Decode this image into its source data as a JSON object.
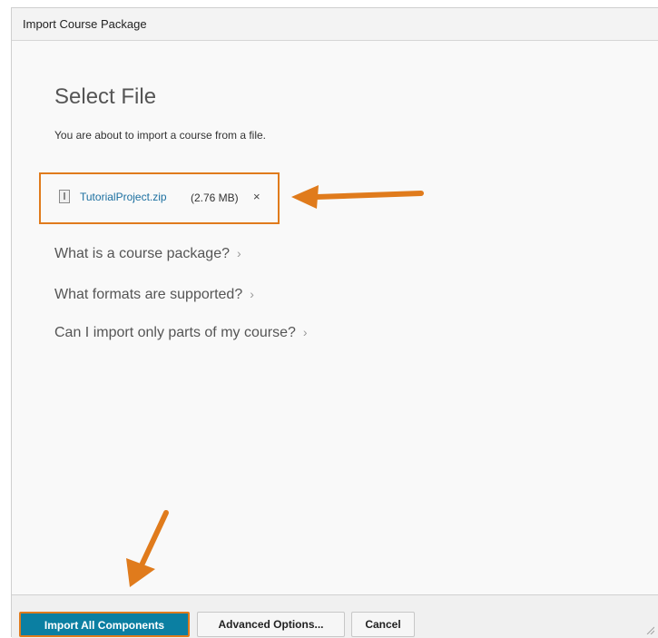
{
  "dialog": {
    "title": "Import Course Package",
    "heading": "Select File",
    "description": "You are about to import a course from a file."
  },
  "file": {
    "name": "TutorialProject.zip",
    "size": "(2.76 MB)",
    "remove": "×"
  },
  "faq": [
    {
      "label": "What is a course package?",
      "chevron": "›"
    },
    {
      "label": "What formats are supported?",
      "chevron": "›"
    },
    {
      "label": "Can I import only parts of my course?",
      "chevron": "›"
    }
  ],
  "footer": {
    "import_all_label": "Import All Components",
    "advanced_label": "Advanced Options...",
    "cancel_label": "Cancel"
  },
  "colors": {
    "accent": "#e07b1c",
    "primary_button": "#0b7fa2",
    "link": "#1b6fa0"
  },
  "icons": {
    "file": "zip-file-icon",
    "annotation_arrow": "orange-arrow-icon"
  }
}
